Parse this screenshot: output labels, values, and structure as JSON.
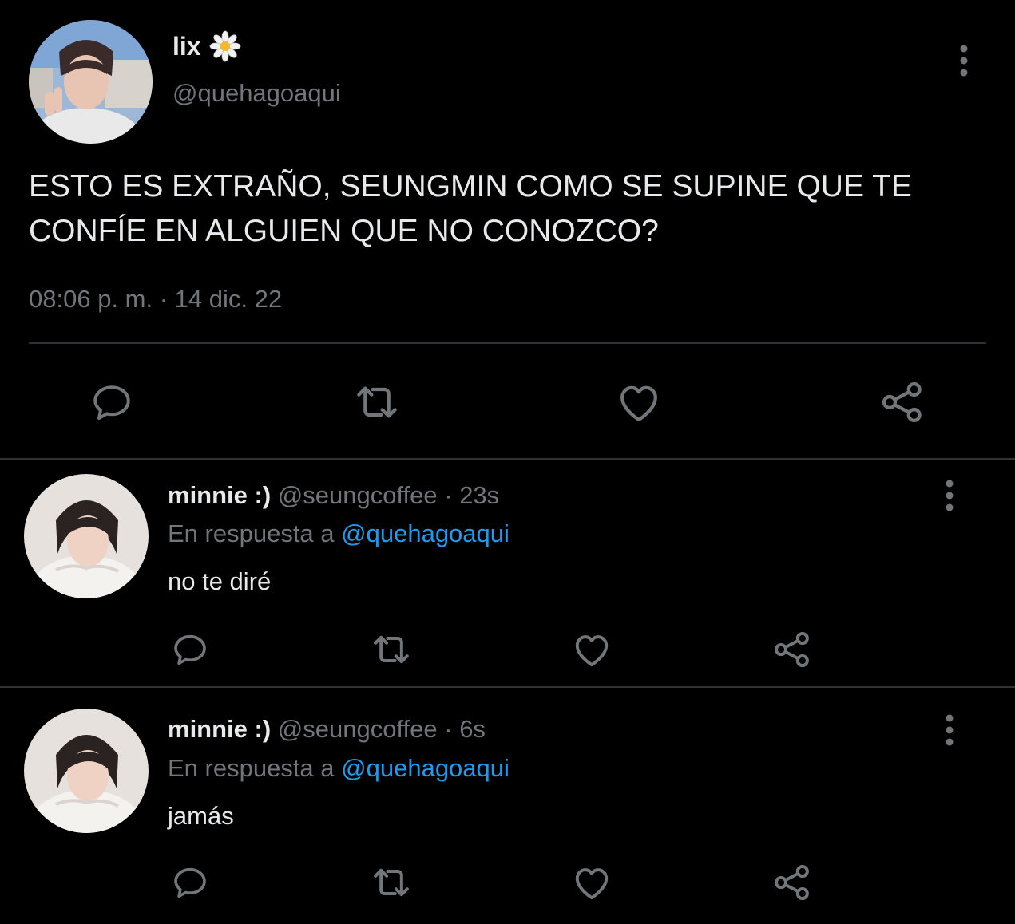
{
  "main_tweet": {
    "author_name": "lix",
    "author_badge_icon": "daisy-icon",
    "handle": "@quehagoaqui",
    "text": "ESTO ES EXTRAÑO, SEUNGMIN COMO SE SUPINE QUE TE CONFÍE EN ALGUIEN QUE NO CONOZCO?",
    "timestamp": "08:06 p. m. · 14 dic. 22"
  },
  "replies": [
    {
      "name": "minnie :)",
      "handle": "@seungcoffee",
      "dot": " · ",
      "time": "23s",
      "reply_prefix": "En respuesta a ",
      "reply_mention": "@quehagoaqui",
      "text": "no te diré"
    },
    {
      "name": "minnie :)",
      "handle": "@seungcoffee",
      "dot": " · ",
      "time": "6s",
      "reply_prefix": "En respuesta a ",
      "reply_mention": "@quehagoaqui",
      "text": "jamás"
    }
  ],
  "colors": {
    "background": "#000000",
    "text": "#e7e9ea",
    "secondary_text": "#71767b",
    "mention": "#1d9bf0",
    "divider": "#2f3336"
  }
}
